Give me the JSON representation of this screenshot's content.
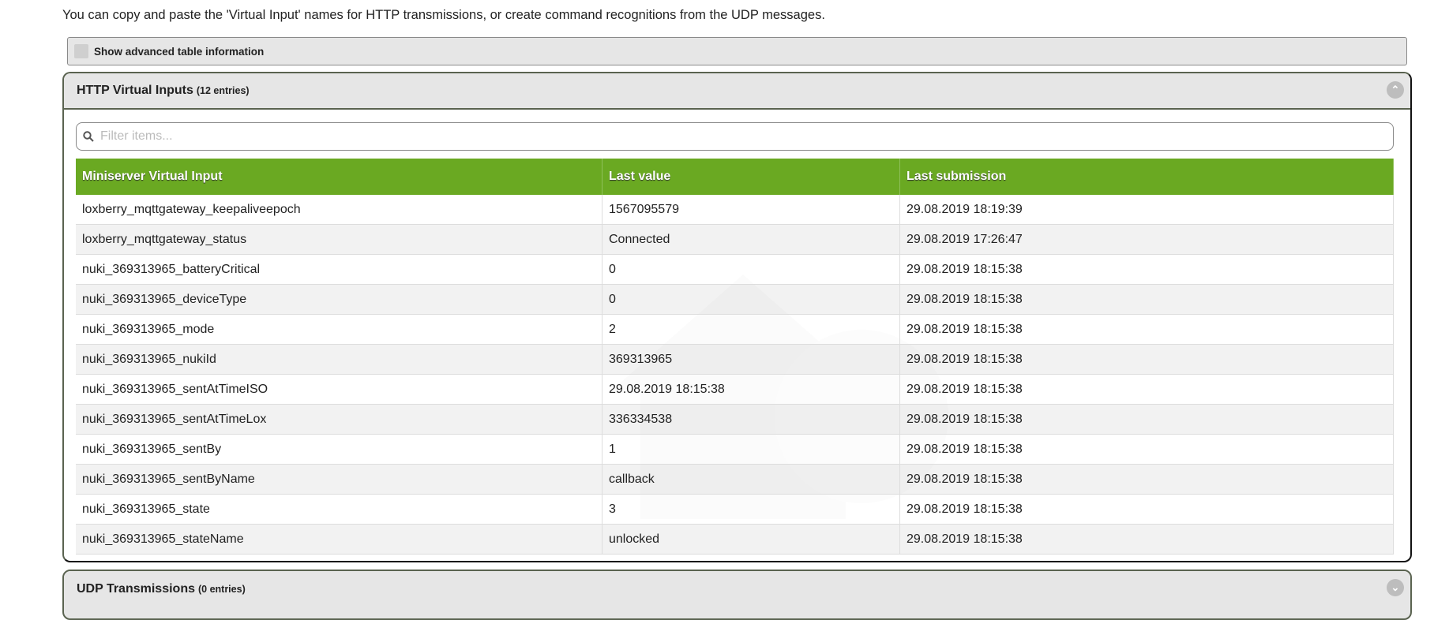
{
  "intro": "You can copy and paste the 'Virtual Input' names for HTTP transmissions, or create command recognitions from the UDP messages.",
  "advanced_checkbox": {
    "label": "Show advanced table information",
    "checked": false
  },
  "http_panel": {
    "title": "HTTP Virtual Inputs",
    "count": "(12 entries)",
    "filter_placeholder": "Filter items...",
    "columns": [
      "Miniserver Virtual Input",
      "Last value",
      "Last submission"
    ],
    "rows": [
      [
        "loxberry_mqttgateway_keepaliveepoch",
        "1567095579",
        "29.08.2019 18:19:39"
      ],
      [
        "loxberry_mqttgateway_status",
        "Connected",
        "29.08.2019 17:26:47"
      ],
      [
        "nuki_369313965_batteryCritical",
        "0",
        "29.08.2019 18:15:38"
      ],
      [
        "nuki_369313965_deviceType",
        "0",
        "29.08.2019 18:15:38"
      ],
      [
        "nuki_369313965_mode",
        "2",
        "29.08.2019 18:15:38"
      ],
      [
        "nuki_369313965_nukiId",
        "369313965",
        "29.08.2019 18:15:38"
      ],
      [
        "nuki_369313965_sentAtTimeISO",
        "29.08.2019 18:15:38",
        "29.08.2019 18:15:38"
      ],
      [
        "nuki_369313965_sentAtTimeLox",
        "336334538",
        "29.08.2019 18:15:38"
      ],
      [
        "nuki_369313965_sentBy",
        "1",
        "29.08.2019 18:15:38"
      ],
      [
        "nuki_369313965_sentByName",
        "callback",
        "29.08.2019 18:15:38"
      ],
      [
        "nuki_369313965_state",
        "3",
        "29.08.2019 18:15:38"
      ],
      [
        "nuki_369313965_stateName",
        "unlocked",
        "29.08.2019 18:15:38"
      ]
    ]
  },
  "udp_panel": {
    "title": "UDP Transmissions",
    "count": "(0 entries)"
  },
  "icons": {
    "collapse": "chevron-up-icon",
    "expand": "chevron-down-icon",
    "search": "search-icon"
  },
  "colors": {
    "header_green": "#6aa922"
  }
}
